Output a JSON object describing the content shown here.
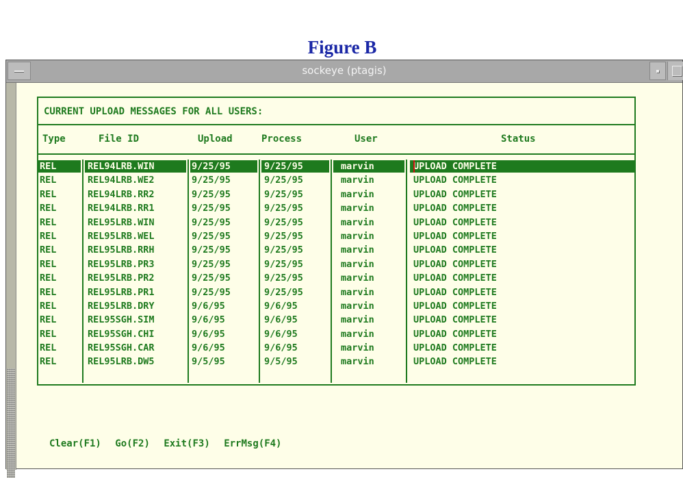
{
  "caption": "Figure B",
  "window": {
    "title": "sockeye (ptagis)"
  },
  "panel": {
    "heading": "CURRENT UPLOAD MESSAGES FOR ALL USERS:",
    "columns": [
      "Type",
      "File ID",
      "Upload",
      "Process",
      "User",
      "Status"
    ],
    "rows": [
      {
        "type": "REL",
        "file_id": "REL94LRB.WIN",
        "upload": "9/25/95",
        "process": "9/25/95",
        "user": "marvin",
        "status": "UPLOAD COMPLETE"
      },
      {
        "type": "REL",
        "file_id": "REL94LRB.WE2",
        "upload": "9/25/95",
        "process": "9/25/95",
        "user": "marvin",
        "status": "UPLOAD COMPLETE"
      },
      {
        "type": "REL",
        "file_id": "REL94LRB.RR2",
        "upload": "9/25/95",
        "process": "9/25/95",
        "user": "marvin",
        "status": "UPLOAD COMPLETE"
      },
      {
        "type": "REL",
        "file_id": "REL94LRB.RR1",
        "upload": "9/25/95",
        "process": "9/25/95",
        "user": "marvin",
        "status": "UPLOAD COMPLETE"
      },
      {
        "type": "REL",
        "file_id": "REL95LRB.WIN",
        "upload": "9/25/95",
        "process": "9/25/95",
        "user": "marvin",
        "status": "UPLOAD COMPLETE"
      },
      {
        "type": "REL",
        "file_id": "REL95LRB.WEL",
        "upload": "9/25/95",
        "process": "9/25/95",
        "user": "marvin",
        "status": "UPLOAD COMPLETE"
      },
      {
        "type": "REL",
        "file_id": "REL95LRB.RRH",
        "upload": "9/25/95",
        "process": "9/25/95",
        "user": "marvin",
        "status": "UPLOAD COMPLETE"
      },
      {
        "type": "REL",
        "file_id": "REL95LRB.PR3",
        "upload": "9/25/95",
        "process": "9/25/95",
        "user": "marvin",
        "status": "UPLOAD COMPLETE"
      },
      {
        "type": "REL",
        "file_id": "REL95LRB.PR2",
        "upload": "9/25/95",
        "process": "9/25/95",
        "user": "marvin",
        "status": "UPLOAD COMPLETE"
      },
      {
        "type": "REL",
        "file_id": "REL95LRB.PR1",
        "upload": "9/25/95",
        "process": "9/25/95",
        "user": "marvin",
        "status": "UPLOAD COMPLETE"
      },
      {
        "type": "REL",
        "file_id": "REL95LRB.DRY",
        "upload": "9/6/95",
        "process": "9/6/95",
        "user": "marvin",
        "status": "UPLOAD COMPLETE"
      },
      {
        "type": "REL",
        "file_id": "REL95SGH.SIM",
        "upload": "9/6/95",
        "process": "9/6/95",
        "user": "marvin",
        "status": "UPLOAD COMPLETE"
      },
      {
        "type": "REL",
        "file_id": "REL95SGH.CHI",
        "upload": "9/6/95",
        "process": "9/6/95",
        "user": "marvin",
        "status": "UPLOAD COMPLETE"
      },
      {
        "type": "REL",
        "file_id": "REL95SGH.CAR",
        "upload": "9/6/95",
        "process": "9/6/95",
        "user": "marvin",
        "status": "UPLOAD COMPLETE"
      },
      {
        "type": "REL",
        "file_id": "REL95LRB.DW5",
        "upload": "9/5/95",
        "process": "9/5/95",
        "user": "marvin",
        "status": "UPLOAD COMPLETE"
      }
    ]
  },
  "fkeys": [
    "Clear(F1)",
    "Go(F2)",
    "Exit(F3)",
    "ErrMsg(F4)"
  ],
  "colors": {
    "terminal_green": "#1e7a1e",
    "background": "#fefee8",
    "caption_blue": "#1a27a6"
  }
}
